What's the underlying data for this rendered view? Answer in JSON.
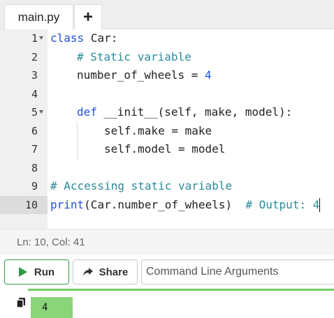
{
  "tabs": {
    "active_label": "main.py",
    "add_label": "+"
  },
  "editor": {
    "lines": [
      {
        "n": "1"
      },
      {
        "n": "2"
      },
      {
        "n": "3"
      },
      {
        "n": "4"
      },
      {
        "n": "5"
      },
      {
        "n": "6"
      },
      {
        "n": "7"
      },
      {
        "n": "8"
      },
      {
        "n": "9"
      },
      {
        "n": "10"
      }
    ],
    "tokens": {
      "l1_kw": "class",
      "l1_rest": " Car:",
      "l2_cm": "# Static variable",
      "l3_a": "number_of_wheels = ",
      "l3_num": "4",
      "l5_kw": "def",
      "l5_rest": " __init__(self, make, model):",
      "l6": "self.make = make",
      "l7": "self.model = model",
      "l9_cm": "# Accessing static variable",
      "l10_fn": "print",
      "l10_rest": "(Car.number_of_wheels)  ",
      "l10_cm": "# Output: 4"
    }
  },
  "status": {
    "text": "Ln: 10,  Col: 41"
  },
  "toolbar": {
    "run_label": "Run",
    "share_label": "Share",
    "args_placeholder": "Command Line Arguments"
  },
  "output": {
    "value": "4"
  },
  "colors": {
    "keyword": "#1f4fd8",
    "comment": "#2a8a9a",
    "run_green": "#2e9a44",
    "output_green": "#8ad47a"
  }
}
